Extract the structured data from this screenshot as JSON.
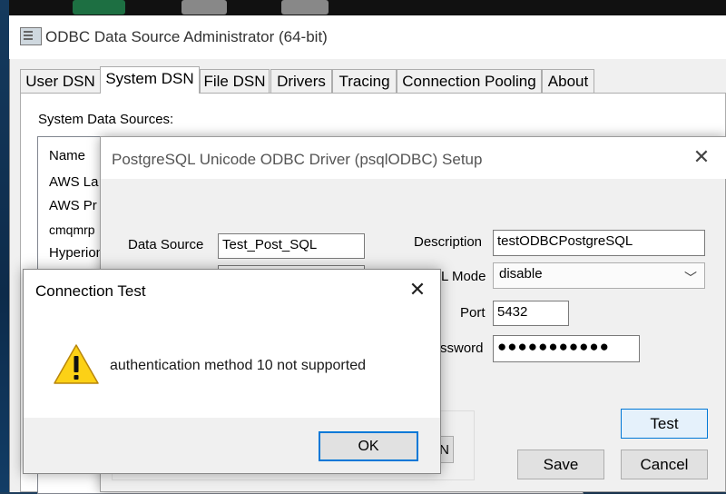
{
  "admin_window": {
    "title": "ODBC Data Source Administrator (64-bit)",
    "tabs": [
      "User DSN",
      "System DSN",
      "File DSN",
      "Drivers",
      "Tracing",
      "Connection Pooling",
      "About"
    ],
    "active_tab": "System DSN",
    "section_label": "System Data Sources:",
    "list_header": "Name",
    "list_items": [
      "AWS La",
      "AWS Pr",
      "cmqmrp",
      "Hyperion"
    ]
  },
  "setup_dialog": {
    "title": "PostgreSQL Unicode ODBC Driver (psqlODBC) Setup",
    "data_source_label": "Data Source",
    "data_source_value": "Test_Post_SQL",
    "description_label": "Description",
    "description_value": "testODBCPostgreSQL",
    "ssl_mode_label": "L Mode",
    "ssl_mode_value": "disable",
    "port_label": "Port",
    "port_value": "5432",
    "password_label": "ssword",
    "password_mask": "●●●●●●●●●●●",
    "test_button": "Test",
    "save_button": "Save",
    "cancel_button": "Cancel",
    "partial_button": "N"
  },
  "message_box": {
    "title": "Connection Test",
    "message": "authentication method 10 not supported",
    "ok_button": "OK"
  },
  "colors": {
    "accent": "#0078d7",
    "warning_fill": "#fcd116"
  }
}
